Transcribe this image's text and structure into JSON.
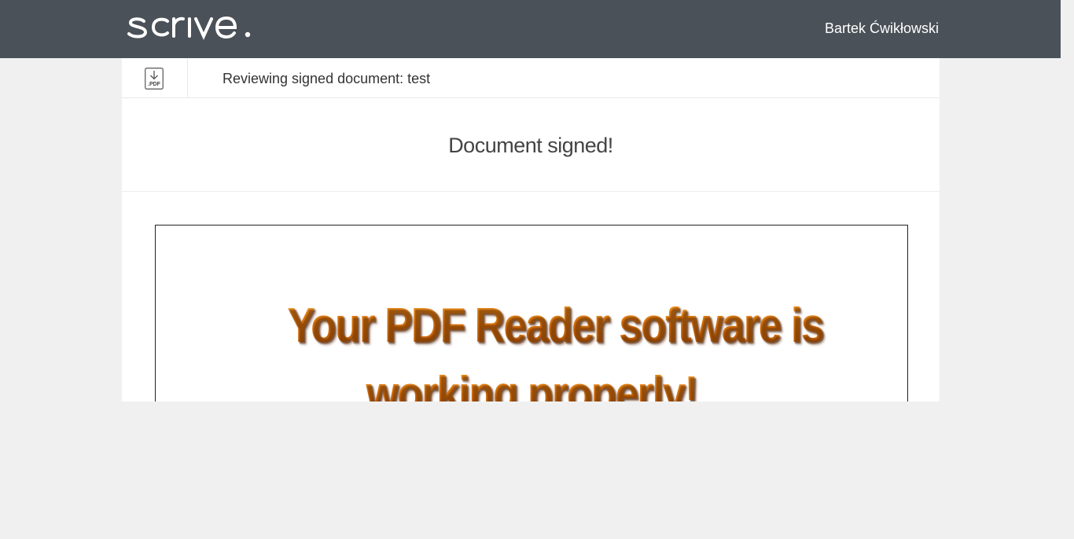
{
  "header": {
    "logo_text": "scrive.",
    "user_name": "Bartek Ćwikłowski",
    "background_color": "#4b5158"
  },
  "document_bar": {
    "download_icon": "pdf-download-icon",
    "download_icon_label": ".PDF",
    "title": "Reviewing signed document: test"
  },
  "status": {
    "message": "Document signed!"
  },
  "pdf_preview": {
    "line1": "Your PDF Reader software is",
    "line2": "working properly!",
    "text_color": "#e47a10"
  }
}
